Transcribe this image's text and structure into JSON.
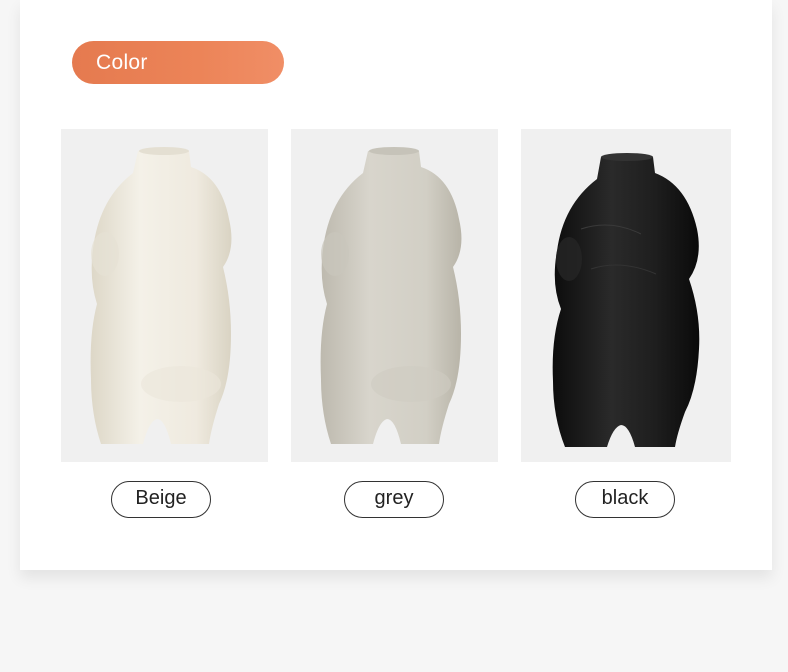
{
  "section": {
    "color_label": "Color"
  },
  "options": [
    {
      "label": "Beige",
      "color": "#f1ede1",
      "shade": "#ddd7c7"
    },
    {
      "label": "grey",
      "color": "#d3d0c6",
      "shade": "#bdb9ae"
    },
    {
      "label": "black",
      "color": "#1c1c1c",
      "shade": "#0c0c0c"
    }
  ],
  "colors": {
    "accent": "#e97f53",
    "panel_bg": "#f0f0f0",
    "page_bg": "#f6f6f6"
  }
}
